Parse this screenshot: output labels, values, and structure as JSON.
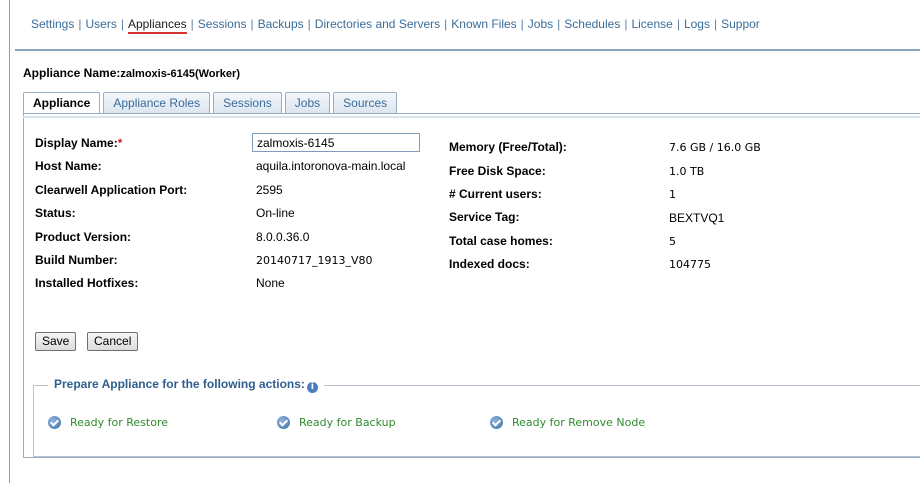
{
  "topnav": {
    "items": [
      "Settings",
      "Users",
      "Appliances",
      "Sessions",
      "Backups",
      "Directories and Servers",
      "Known Files",
      "Jobs",
      "Schedules",
      "License",
      "Logs",
      "Suppor"
    ],
    "active_index": 2
  },
  "appliance": {
    "name_label": "Appliance Name:",
    "name_value": "zalmoxis-6145(Worker)"
  },
  "tabs": [
    "Appliance",
    "Appliance Roles",
    "Sessions",
    "Jobs",
    "Sources"
  ],
  "active_tab": 0,
  "left_fields": [
    {
      "label": "Display Name:",
      "value": "zalmoxis-6145"
    },
    {
      "label": "Host Name:",
      "value": "aquila.intoronova-main.local"
    },
    {
      "label": "Clearwell Application Port:",
      "value": "2595"
    },
    {
      "label": "Status:",
      "value": "On-line"
    },
    {
      "label": "Product Version:",
      "value": "8.0.0.36.0"
    },
    {
      "label": "Build Number:",
      "value": "20140717_1913_V80"
    },
    {
      "label": "Installed Hotfixes:",
      "value": "None"
    }
  ],
  "required_marker": "*",
  "right_fields": [
    {
      "label": "Memory (Free/Total):",
      "value": "7.6 GB / 16.0 GB"
    },
    {
      "label": "Free Disk Space:",
      "value": "1.0 TB"
    },
    {
      "label": "# Current users:",
      "value": "1"
    },
    {
      "label": "Service Tag:",
      "value": "BEXTVQ1"
    },
    {
      "label": "Total case homes:",
      "value": "5"
    },
    {
      "label": "Indexed docs:",
      "value": "104775"
    }
  ],
  "buttons": {
    "save": "Save",
    "cancel": "Cancel"
  },
  "prepare": {
    "legend": "Prepare Appliance for the following actions:",
    "info_icon": "info-icon",
    "items": [
      "Ready for Restore",
      "Ready for Backup",
      "Ready for Remove Node"
    ]
  },
  "colors": {
    "link": "#3a6c9a",
    "ready": "#2e8b2e",
    "required": "#d02020",
    "legend": "#2f5f8e"
  }
}
